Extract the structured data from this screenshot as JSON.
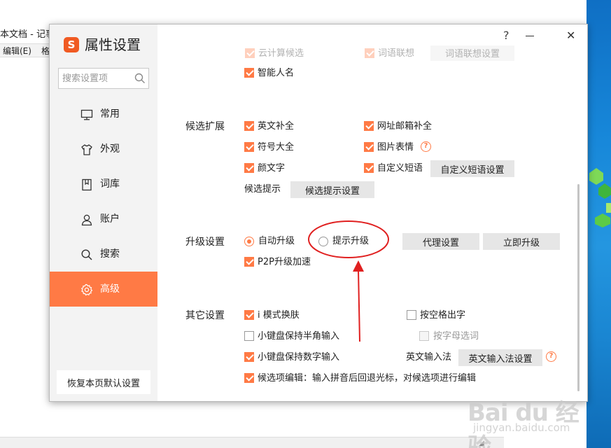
{
  "background": {
    "notepad_title": "本文档 - 记事",
    "notepad_menu": [
      "编辑(E)",
      "格"
    ]
  },
  "dialog": {
    "title": "属性设置",
    "logo_letter": "S",
    "help": "?",
    "close": "✕"
  },
  "sidebar": {
    "search_placeholder": "搜索设置项",
    "items": [
      {
        "label": "常用",
        "icon": "monitor-icon",
        "active": false
      },
      {
        "label": "外观",
        "icon": "shirt-icon",
        "active": false
      },
      {
        "label": "词库",
        "icon": "book-icon",
        "active": false
      },
      {
        "label": "账户",
        "icon": "user-icon",
        "active": false
      },
      {
        "label": "搜索",
        "icon": "search-icon",
        "active": false
      },
      {
        "label": "高级",
        "icon": "gear-icon",
        "active": true
      }
    ],
    "reset_button": "恢复本页默认设置"
  },
  "content": {
    "partial_top": {
      "left_label": "云计算候选",
      "mid_label": "词语联想",
      "button": "词语联想设置"
    },
    "smart_name": {
      "label": "智能人名",
      "checked": true
    },
    "candidate_ext": {
      "title": "候选扩展",
      "options": [
        {
          "label": "英文补全",
          "checked": true
        },
        {
          "label": "网址邮箱补全",
          "checked": true
        },
        {
          "label": "符号大全",
          "checked": true
        },
        {
          "label": "图片表情",
          "checked": true
        },
        {
          "label": "颜文字",
          "checked": true
        },
        {
          "label": "自定义短语",
          "checked": true
        }
      ],
      "phrase_button": "自定义短语设置",
      "hint_label": "候选提示",
      "hint_button": "候选提示设置"
    },
    "upgrade": {
      "title": "升级设置",
      "radio_auto": "自动升级",
      "radio_prompt": "提示升级",
      "selected": "自动升级",
      "proxy_button": "代理设置",
      "upgrade_now_button": "立即升级",
      "p2p_label": "P2P升级加速",
      "p2p_checked": true
    },
    "other": {
      "title": "其它设置",
      "options": [
        {
          "label": "i 模式换肤",
          "checked": true
        },
        {
          "label": "按空格出字",
          "checked": false
        },
        {
          "label": "小键盘保持半角输入",
          "checked": false
        },
        {
          "label": "按字母选词",
          "checked": false,
          "disabled": true
        },
        {
          "label": "小键盘保持数字输入",
          "checked": true
        },
        {
          "label": "候选项编辑：输入拼音后回退光标，对候选项进行编辑",
          "checked": true
        }
      ],
      "en_ime_label": "英文输入法",
      "en_ime_button": "英文输入法设置"
    }
  },
  "watermark": {
    "brand": "Bai du 经验",
    "url": "jingyan.baidu.com"
  },
  "colors": {
    "accent": "#ff7a45",
    "annotation": "#e02020",
    "sidebar_bg": "#f3f3f3",
    "button_bg": "#e6e6e6"
  }
}
